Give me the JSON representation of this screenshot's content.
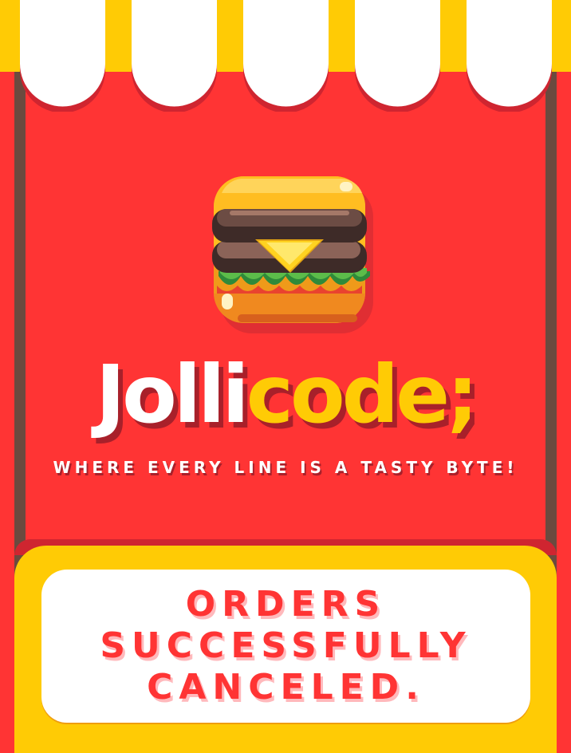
{
  "brand": {
    "name_white": "Jolli",
    "name_yellow": "code;",
    "tagline": "WHERE EVERY LINE IS A TASTY BYTE!"
  },
  "status": {
    "line1": "ORDERS",
    "line2": "SUCCESSFULLY",
    "line3": "CANCELED."
  },
  "icons": {
    "logo": "burger-icon",
    "awning": "striped-awning"
  },
  "colors": {
    "background_red": "#ff3434",
    "brand_yellow": "#ffcb05",
    "white": "#ffffff",
    "shadow_red": "#a8202a",
    "wall_brown": "#6b4a3f"
  }
}
